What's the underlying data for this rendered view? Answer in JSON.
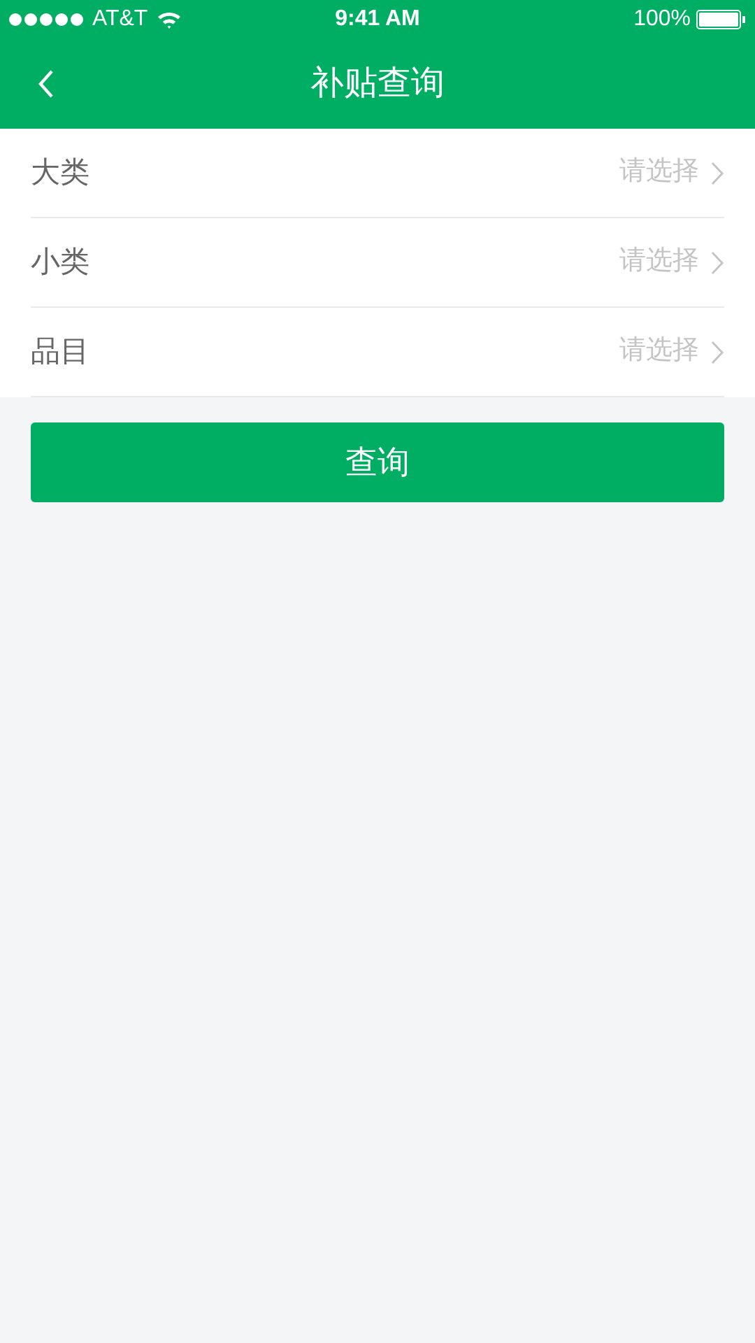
{
  "status_bar": {
    "carrier": "AT&T",
    "time": "9:41 AM",
    "battery": "100%"
  },
  "header": {
    "title": "补贴查询"
  },
  "fields": [
    {
      "label": "大类",
      "placeholder": "请选择"
    },
    {
      "label": "小类",
      "placeholder": "请选择"
    },
    {
      "label": "品目",
      "placeholder": "请选择"
    }
  ],
  "button": "查询"
}
